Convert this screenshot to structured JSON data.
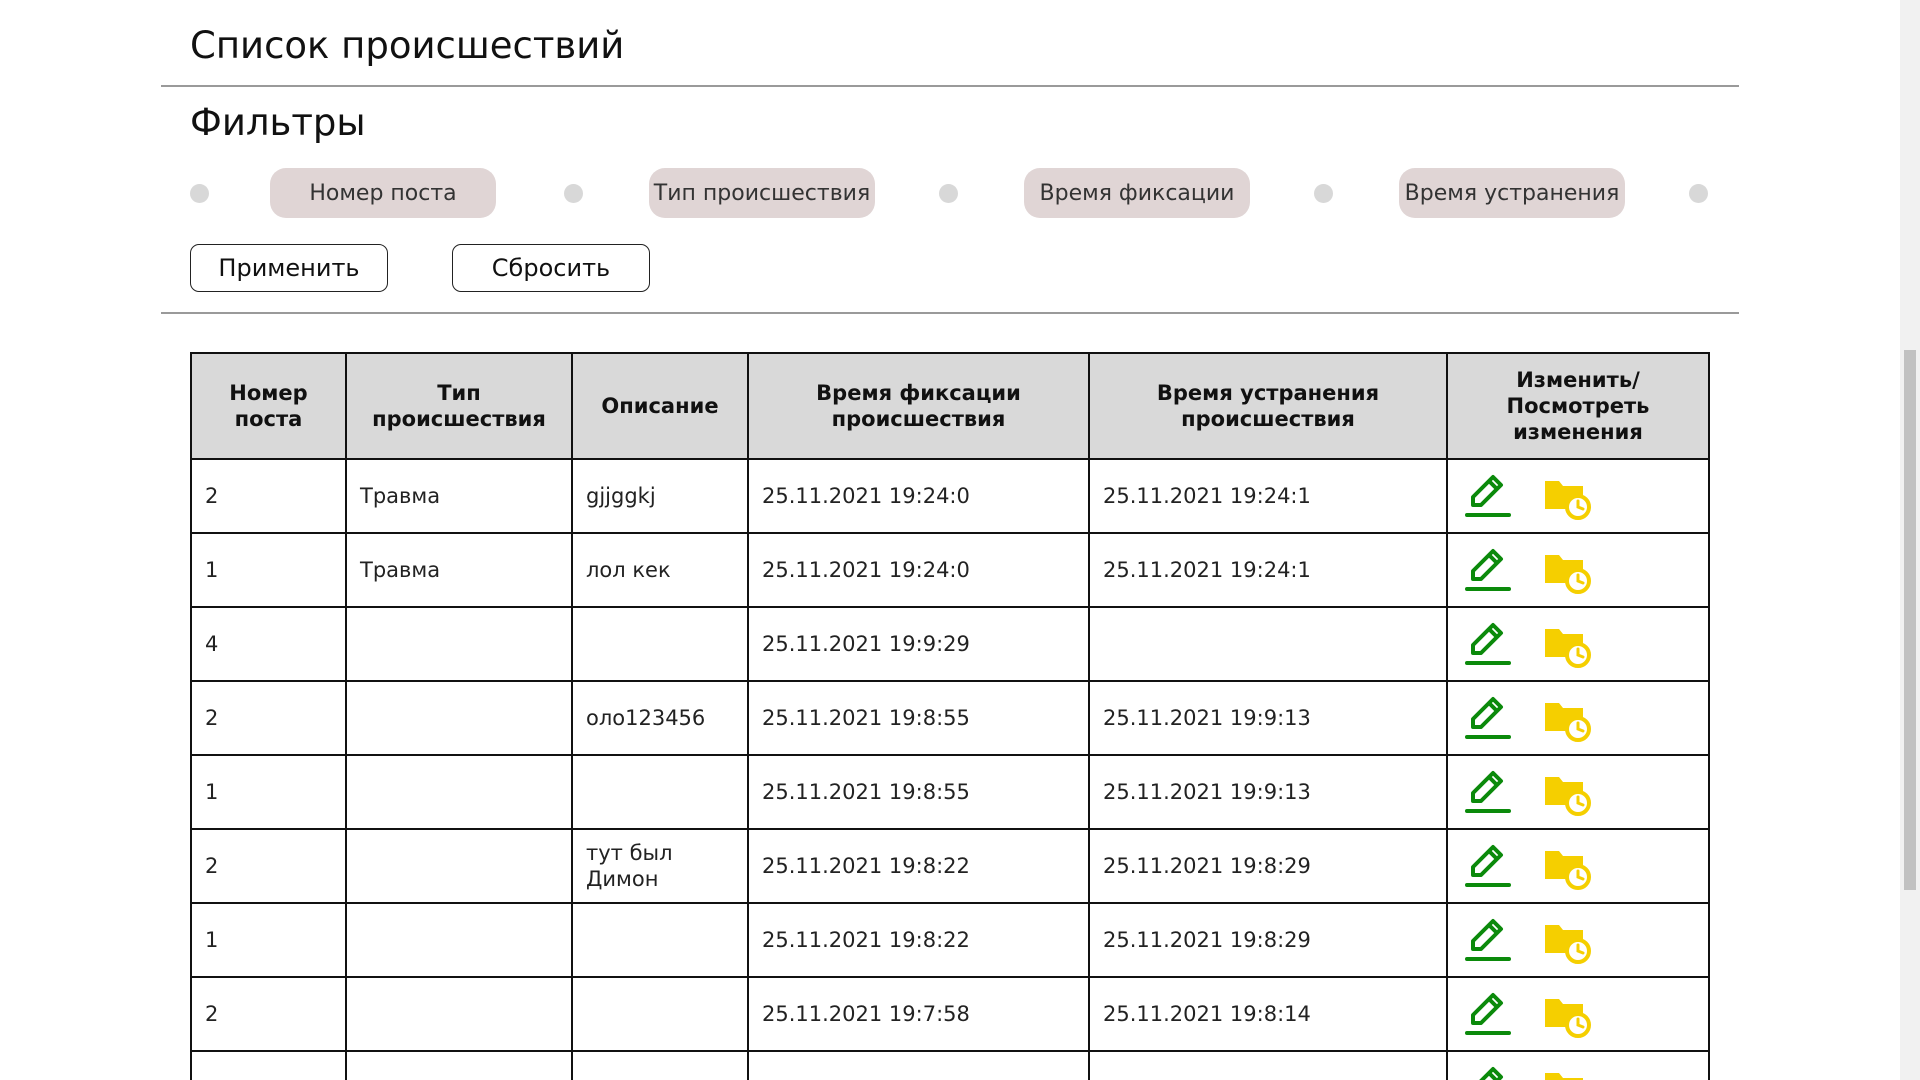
{
  "page": {
    "title": "Список происшествий"
  },
  "filters": {
    "title": "Фильтры",
    "pills": [
      {
        "label": "Номер поста"
      },
      {
        "label": "Тип происшествия"
      },
      {
        "label": "Время фиксации"
      },
      {
        "label": "Время устранения"
      }
    ],
    "apply_label": "Применить",
    "reset_label": "Сбросить"
  },
  "table": {
    "headers": {
      "post": "Номер поста",
      "type": "Тип происшествия",
      "description": "Описание",
      "fixed_at": "Время фиксации происшествия",
      "resolved_at": "Время устранения происшествия",
      "actions": "Изменить/ Посмотреть изменения"
    },
    "rows": [
      {
        "post": "2",
        "type": "Травма",
        "description": "gjjggkj",
        "fixed_at": "25.11.2021 19:24:0",
        "resolved_at": "25.11.2021 19:24:1"
      },
      {
        "post": "1",
        "type": "Травма",
        "description": "лол кек",
        "fixed_at": "25.11.2021 19:24:0",
        "resolved_at": "25.11.2021 19:24:1"
      },
      {
        "post": "4",
        "type": "",
        "description": "",
        "fixed_at": "25.11.2021 19:9:29",
        "resolved_at": ""
      },
      {
        "post": "2",
        "type": "",
        "description": "оло123456",
        "fixed_at": "25.11.2021 19:8:55",
        "resolved_at": "25.11.2021 19:9:13"
      },
      {
        "post": "1",
        "type": "",
        "description": "",
        "fixed_at": "25.11.2021 19:8:55",
        "resolved_at": "25.11.2021 19:9:13"
      },
      {
        "post": "2",
        "type": "",
        "description": "тут был Димон",
        "fixed_at": "25.11.2021 19:8:22",
        "resolved_at": "25.11.2021 19:8:29"
      },
      {
        "post": "1",
        "type": "",
        "description": "",
        "fixed_at": "25.11.2021 19:8:22",
        "resolved_at": "25.11.2021 19:8:29"
      },
      {
        "post": "2",
        "type": "",
        "description": "",
        "fixed_at": "25.11.2021 19:7:58",
        "resolved_at": "25.11.2021 19:8:14"
      },
      {
        "post": "",
        "type": "",
        "description": "",
        "fixed_at": "",
        "resolved_at": ""
      }
    ],
    "icons": {
      "edit": "pencil-icon",
      "history": "folder-clock-icon"
    }
  },
  "colors": {
    "edit_icon": "#0b8a0b",
    "history_icon": "#f5cf00",
    "pill_bg": "#e0d5d5",
    "header_bg": "#d9d9d9"
  }
}
